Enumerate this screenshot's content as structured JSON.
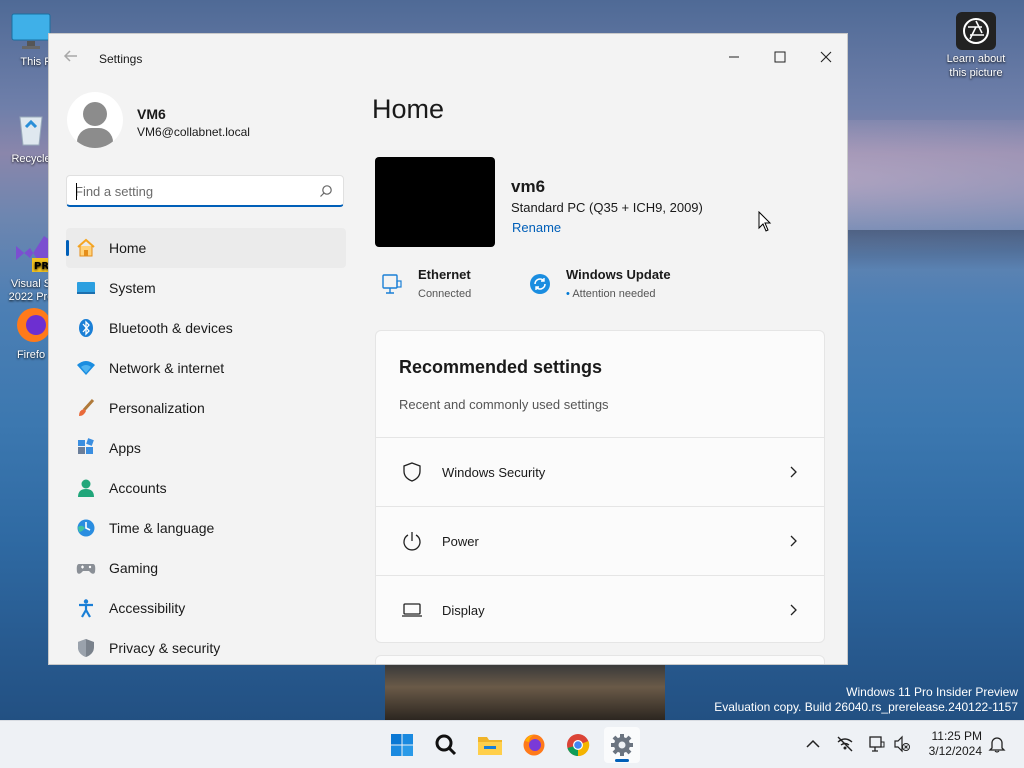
{
  "desktop": {
    "icons": [
      {
        "label": "This P"
      },
      {
        "label": "Recycle"
      },
      {
        "label": "Visual S\n2022 Pre"
      },
      {
        "label": "Firefo"
      }
    ],
    "learn_label": "Learn about\nthis picture"
  },
  "window": {
    "title": "Settings",
    "user": {
      "name": "VM6",
      "email": "VM6@collabnet.local"
    },
    "search": {
      "placeholder": "Find a setting"
    },
    "nav": [
      {
        "label": "Home",
        "icon": "home-icon",
        "active": true
      },
      {
        "label": "System",
        "icon": "system-icon"
      },
      {
        "label": "Bluetooth & devices",
        "icon": "bluetooth-icon"
      },
      {
        "label": "Network & internet",
        "icon": "network-icon"
      },
      {
        "label": "Personalization",
        "icon": "brush-icon"
      },
      {
        "label": "Apps",
        "icon": "apps-icon"
      },
      {
        "label": "Accounts",
        "icon": "accounts-icon"
      },
      {
        "label": "Time & language",
        "icon": "time-language-icon"
      },
      {
        "label": "Gaming",
        "icon": "gaming-icon"
      },
      {
        "label": "Accessibility",
        "icon": "accessibility-icon"
      },
      {
        "label": "Privacy & security",
        "icon": "shield-icon"
      }
    ],
    "main": {
      "title": "Home",
      "pc": {
        "name": "vm6",
        "model": "Standard PC (Q35 + ICH9, 2009)",
        "rename": "Rename"
      },
      "status": [
        {
          "title": "Ethernet",
          "sub": "Connected"
        },
        {
          "title": "Windows Update",
          "sub": "Attention needed"
        }
      ],
      "recommended": {
        "title": "Recommended settings",
        "subtitle": "Recent and commonly used settings",
        "items": [
          {
            "label": "Windows Security",
            "icon": "shield-icon"
          },
          {
            "label": "Power",
            "icon": "power-icon"
          },
          {
            "label": "Display",
            "icon": "display-icon"
          }
        ]
      }
    }
  },
  "watermark": {
    "line1": "Windows 11 Pro Insider Preview",
    "line2": "Evaluation copy. Build 26040.rs_prerelease.240122-1157"
  },
  "taskbar": {
    "clock": {
      "time": "11:25 PM",
      "date": "3/12/2024"
    }
  },
  "colors": {
    "accent": "#005fb8",
    "update_blue": "#0078d4"
  }
}
